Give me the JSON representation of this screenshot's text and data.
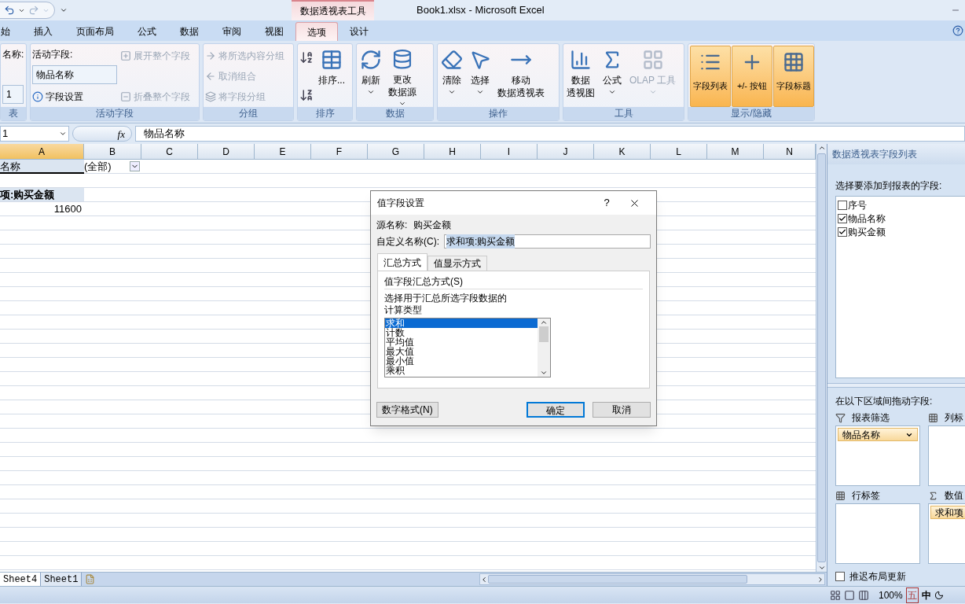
{
  "title_bar": {
    "contextual_tab": "数据透视表工具",
    "title": "Book1.xlsx - Microsoft Excel"
  },
  "tabs": [
    {
      "label": "始",
      "selected": false
    },
    {
      "label": "插入",
      "selected": false
    },
    {
      "label": "页面布局",
      "selected": false
    },
    {
      "label": "公式",
      "selected": false
    },
    {
      "label": "数据",
      "selected": false
    },
    {
      "label": "审阅",
      "selected": false
    },
    {
      "label": "视图",
      "selected": false
    },
    {
      "label": "选项",
      "selected": true
    },
    {
      "label": "设计",
      "selected": false
    }
  ],
  "ribbon": {
    "groups": [
      {
        "label": "表",
        "columns": [
          [
            {
              "kind": "caption",
              "text": "名称:"
            },
            {
              "kind": "field",
              "value": "1"
            }
          ]
        ]
      },
      {
        "label": "活动字段",
        "columns": [
          [
            {
              "kind": "caption",
              "text": "活动字段:"
            },
            {
              "kind": "field",
              "value": "物品名称"
            },
            {
              "kind": "small",
              "text": "字段设置",
              "disabled": false
            }
          ],
          [
            {
              "kind": "small",
              "text": "展开整个字段",
              "disabled": true
            },
            {
              "kind": "small",
              "text": "折叠整个字段",
              "disabled": true
            }
          ]
        ]
      },
      {
        "label": "分组",
        "columns": [
          [
            {
              "kind": "small",
              "text": "将所选内容分组",
              "disabled": true
            },
            {
              "kind": "small",
              "text": "取消组合",
              "disabled": true
            },
            {
              "kind": "small",
              "text": "将字段分组",
              "disabled": true
            }
          ]
        ]
      },
      {
        "label": "排序",
        "columns": [
          [
            {
              "kind": "icon",
              "disabled": false
            },
            {
              "kind": "icon",
              "disabled": false
            }
          ],
          [
            {
              "kind": "large",
              "lines": [
                "排序..."
              ],
              "dropdown": false,
              "disabled": false
            }
          ]
        ]
      },
      {
        "label": "数据",
        "columns": [
          [
            {
              "kind": "large",
              "lines": [
                "刷新"
              ],
              "dropdown": true,
              "disabled": false
            }
          ],
          [
            {
              "kind": "large",
              "lines": [
                "更改",
                "数据源"
              ],
              "dropdown": true,
              "disabled": false
            }
          ]
        ]
      },
      {
        "label": "操作",
        "columns": [
          [
            {
              "kind": "large",
              "lines": [
                "清除"
              ],
              "dropdown": true,
              "disabled": false
            }
          ],
          [
            {
              "kind": "large",
              "lines": [
                "选择"
              ],
              "dropdown": true,
              "disabled": false
            }
          ],
          [
            {
              "kind": "large",
              "lines": [
                "移动",
                "数据透视表"
              ],
              "dropdown": false,
              "disabled": false
            }
          ]
        ]
      },
      {
        "label": "工具",
        "columns": [
          [
            {
              "kind": "large",
              "lines": [
                "数据",
                "透视图"
              ],
              "dropdown": false,
              "disabled": false
            }
          ],
          [
            {
              "kind": "large",
              "lines": [
                "公式"
              ],
              "dropdown": true,
              "disabled": false
            }
          ],
          [
            {
              "kind": "large",
              "lines": [
                "OLAP 工具"
              ],
              "dropdown": true,
              "disabled": true
            }
          ]
        ]
      },
      {
        "label": "显示/隐藏",
        "columns": [
          [
            {
              "kind": "toggle",
              "text": "字段列表",
              "on": true
            }
          ],
          [
            {
              "kind": "toggle",
              "text": "+/- 按钮",
              "on": true
            }
          ],
          [
            {
              "kind": "toggle",
              "text": "字段标题",
              "on": true
            }
          ]
        ]
      }
    ]
  },
  "formula_bar": {
    "name_box": "1",
    "function_button": "fx",
    "formula": "物品名称"
  },
  "sheet": {
    "columns": [
      {
        "label": "A",
        "selected": true
      },
      {
        "label": "B",
        "selected": false
      },
      {
        "label": "C",
        "selected": false
      },
      {
        "label": "D",
        "selected": false
      },
      {
        "label": "E",
        "selected": false
      },
      {
        "label": "F",
        "selected": false
      },
      {
        "label": "G",
        "selected": false
      },
      {
        "label": "H",
        "selected": false
      },
      {
        "label": "I",
        "selected": false
      },
      {
        "label": "J",
        "selected": false
      },
      {
        "label": "K",
        "selected": false
      },
      {
        "label": "L",
        "selected": false
      },
      {
        "label": "M",
        "selected": false
      },
      {
        "label": "N",
        "selected": false
      }
    ],
    "pivot": {
      "filter_field": "名称",
      "filter_value": "(全部)",
      "value_header": "项:购买金额",
      "total": "11600"
    }
  },
  "sheet_tabs": [
    {
      "label": "Sheet4",
      "selected": true
    },
    {
      "label": "Sheet1",
      "selected": false
    }
  ],
  "dialog": {
    "title": "值字段设置",
    "help": "?",
    "source_label": "源名称:",
    "source_value": "购买金额",
    "custom_label": "自定义名称(C):",
    "custom_value": "求和项:购买金额",
    "tabs": [
      {
        "label": "汇总方式",
        "selected": true
      },
      {
        "label": "值显示方式",
        "selected": false
      }
    ],
    "section": "值字段汇总方式(S)",
    "description": "选择用于汇总所选字段数据的计算类型",
    "options": [
      {
        "label": "求和",
        "selected": true
      },
      {
        "label": "计数",
        "selected": false
      },
      {
        "label": "平均值",
        "selected": false
      },
      {
        "label": "最大值",
        "selected": false
      },
      {
        "label": "最小值",
        "selected": false
      },
      {
        "label": "乘积",
        "selected": false
      }
    ],
    "buttons": [
      {
        "label": "数字格式(N)",
        "kind": "normal"
      },
      {
        "label": "确定",
        "kind": "default"
      },
      {
        "label": "取消",
        "kind": "normal"
      }
    ]
  },
  "field_list": {
    "title": "数据透视表字段列表",
    "prompt": "选择要添加到报表的字段:",
    "fields": [
      {
        "label": "序号",
        "checked": false
      },
      {
        "label": "物品名称",
        "checked": true
      },
      {
        "label": "购买金额",
        "checked": true
      }
    ],
    "areas_prompt": "在以下区域间拖动字段:",
    "areas": [
      {
        "label": "报表筛选",
        "kind": "filter",
        "items": [
          "物品名称"
        ]
      },
      {
        "label": "列标",
        "kind": "columns"
      },
      {
        "label": "行标签",
        "kind": "rows"
      },
      {
        "label": "数值",
        "kind": "values",
        "items": [
          "求和项"
        ]
      }
    ],
    "defer": {
      "label": "推迟布局更新",
      "checked": false
    }
  },
  "status_bar": {
    "zoom": "100%",
    "ime": [
      "五",
      "中"
    ]
  }
}
